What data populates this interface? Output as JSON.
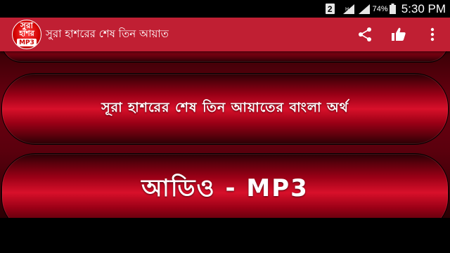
{
  "status_bar": {
    "sim_badge": "2",
    "battery_percent": "74%",
    "time": "5:30 PM",
    "icons": [
      "signal-icon",
      "wifi-icon",
      "battery-icon"
    ]
  },
  "app_bar": {
    "logo": {
      "line1": "সুরা",
      "line2": "হাশর",
      "badge": "MP3"
    },
    "title": "সুরা হাশরের শেষ তিন আয়াত",
    "actions": [
      "share-icon",
      "thumbs-up-icon",
      "overflow-menu-icon"
    ],
    "accent_color": "#c01f33"
  },
  "menu": {
    "items": [
      {
        "label": "সূরা হাশরের শেষ তিন আয়াতের বাংলা অর্থ"
      },
      {
        "label": "আডিও  -  MP3"
      }
    ]
  }
}
